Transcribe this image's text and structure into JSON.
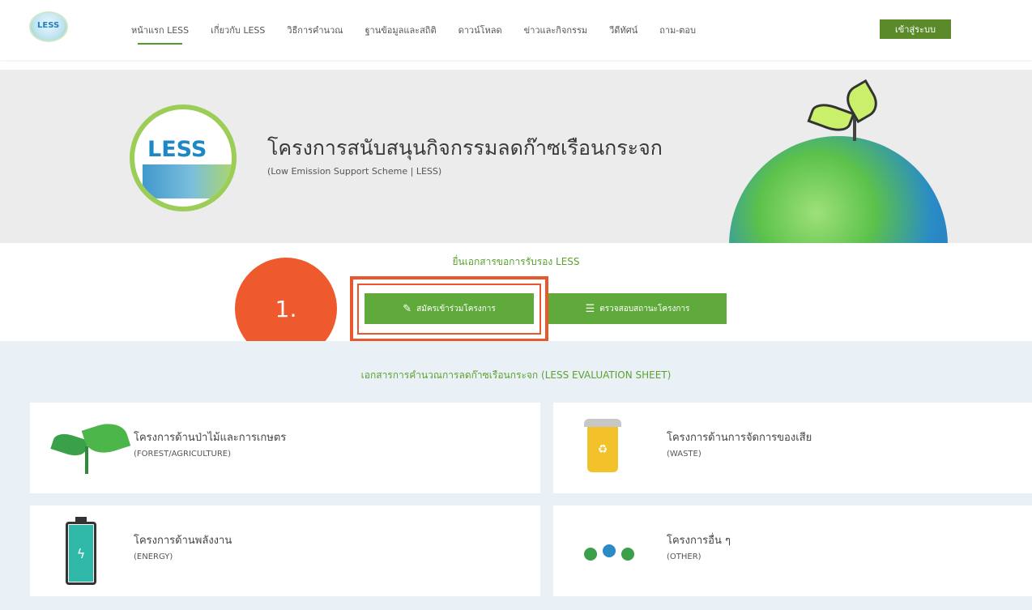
{
  "nav": {
    "logo_text": "LESS",
    "items": [
      {
        "label": "หน้าแรก LESS"
      },
      {
        "label": "เกี่ยวกับ LESS"
      },
      {
        "label": "วิธีการคำนวณ"
      },
      {
        "label": "ฐานข้อมูลและสถิติ"
      },
      {
        "label": "ดาวน์โหลด"
      },
      {
        "label": "ข่าวและกิจกรรม"
      },
      {
        "label": "วีดีทัศน์"
      },
      {
        "label": "ถาม-ตอบ"
      }
    ],
    "login_label": "เข้าสู่ระบบ"
  },
  "hero": {
    "badge_text": "LESS",
    "title": "โครงการสนับสนุนกิจกรรมลดก๊าซเรือนกระจก",
    "subtitle": "(Low Emission Support Scheme | LESS)"
  },
  "submit": {
    "title": "ยื่นเอกสารขอการรับรอง LESS",
    "apply_label": "สมัครเข้าร่วมโครงการ",
    "check_label": "ตรวจสอบสถานะโครงการ"
  },
  "annotation": {
    "label": "1."
  },
  "evaluation": {
    "title": "เอกสารการคำนวณการลดก๊าซเรือนกระจก (LESS EVALUATION SHEET)",
    "cards": [
      {
        "name": "โครงการด้านป่าไม้และการเกษตร",
        "en": "(FOREST/AGRICULTURE)",
        "icon": "plant-icon"
      },
      {
        "name": "โครงการด้านการจัดการของเสีย",
        "en": "(WASTE)",
        "icon": "recycle-bin-icon"
      },
      {
        "name": "โครงการด้านพลังงาน",
        "en": "(ENERGY)",
        "icon": "battery-icon"
      },
      {
        "name": "โครงการอื่น ๆ",
        "en": "(OTHER)",
        "icon": "dots-icon"
      }
    ]
  },
  "colors": {
    "brand_green": "#5faa3a",
    "login_green": "#5b8a2b",
    "annotation_orange": "#ee5a2e",
    "section_bg": "#eaf1f6"
  }
}
